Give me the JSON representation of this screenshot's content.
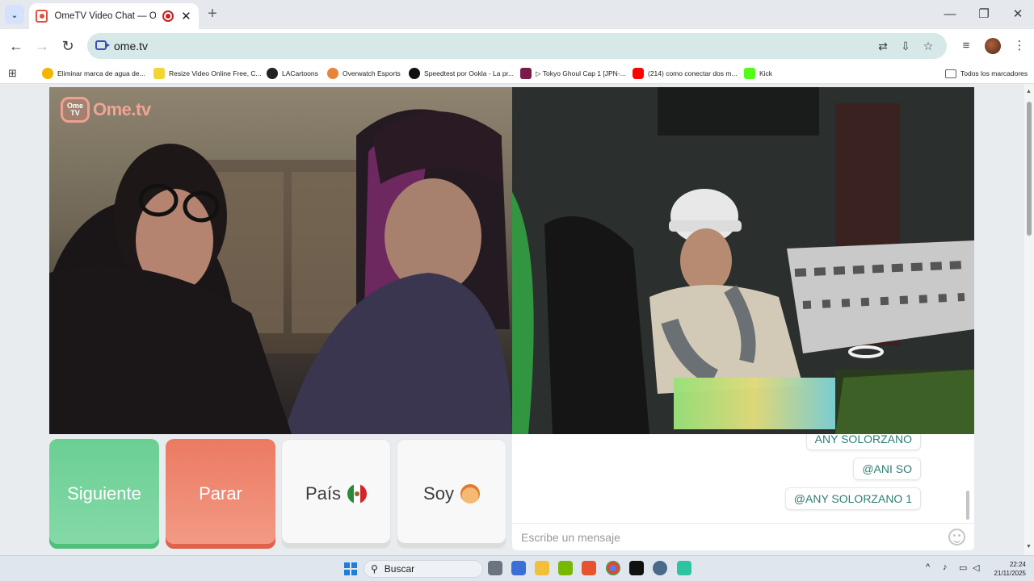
{
  "browser": {
    "tab": {
      "title": "OmeTV Video Chat — Omegle Rand",
      "close_glyph": "✕"
    },
    "new_tab_glyph": "+",
    "window_controls": [
      "—",
      "❐",
      "✕"
    ],
    "address_bar": {
      "url": "ome.tv"
    },
    "bookmarks": [
      {
        "label": "Eliminar marca de agua de...",
        "icon_color": "#f4b400"
      },
      {
        "label": "Resize Video Online Free, C...",
        "icon_color": "#f2d635"
      },
      {
        "label": "LACartoons",
        "icon_color": "#222222"
      },
      {
        "label": "Overwatch Esports",
        "icon_color": "#e8833a"
      },
      {
        "label": "Speedtest por Ookla - La pr...",
        "icon_color": "#111111"
      },
      {
        "label": "▷ Tokyo Ghoul Cap 1 [JPN-...",
        "icon_color": "#7a1c4a"
      },
      {
        "label": "(214) como conectar dos m...",
        "icon_color": "#ff0000"
      },
      {
        "label": "Kick",
        "icon_color": "#53fc18"
      }
    ],
    "all_bookmarks": "Todos los marcadores"
  },
  "ometv": {
    "brand_box": "Ome TV",
    "brand_text": "Ome.tv",
    "buttons": {
      "next": "Siguiente",
      "stop": "Parar",
      "country": "País",
      "gender": "Soy"
    },
    "chat": {
      "messages": [
        "ANY SOLORZANO",
        "@ANI SO",
        "@ANY SOLORZANO 1"
      ],
      "placeholder": "Escribe un mensaje"
    }
  },
  "taskbar": {
    "search_label": "Buscar",
    "tray_chevron": "^",
    "time": "22:24",
    "date": "21/11/2025"
  },
  "colors": {
    "next_button": "#6bcf93",
    "stop_button": "#ec7a62",
    "chat_text": "#2e7d74",
    "omnibox": "#d7e8e8"
  }
}
